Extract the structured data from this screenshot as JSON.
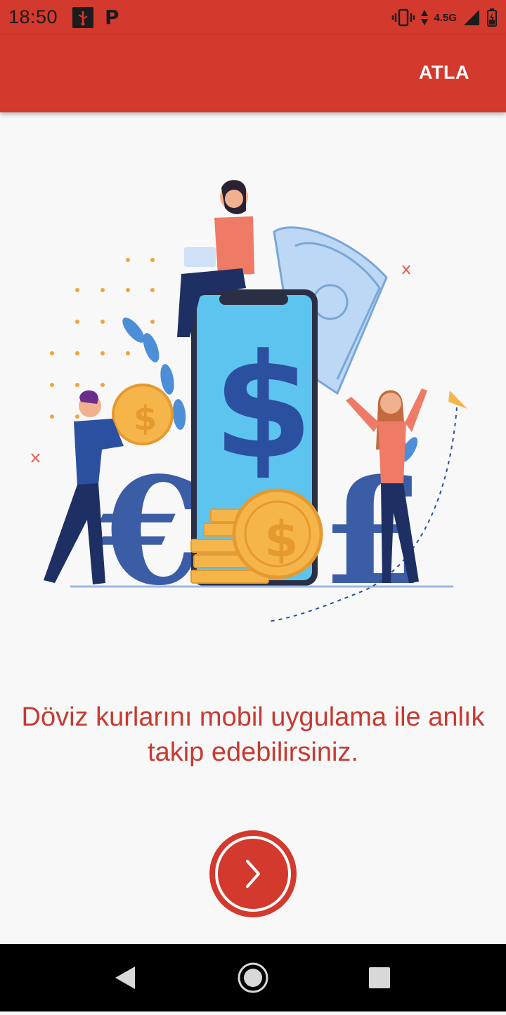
{
  "status_bar": {
    "time": "18:50",
    "network": "4.5G",
    "left_icons": [
      "usb-debug-icon",
      "parking-p-icon"
    ],
    "right_icons": [
      "vibrate-icon",
      "data-arrows-icon",
      "signal-icon",
      "battery-icon"
    ]
  },
  "app_bar": {
    "skip_label": "ATLA"
  },
  "illustration": {
    "icon": "currency-exchange-illustration",
    "symbols": [
      "$",
      "€",
      "£"
    ]
  },
  "onboarding": {
    "message": "Döviz kurlarını mobil uygulama ile anlık takip edebilirsiniz."
  },
  "next_button": {
    "icon": "chevron-right-icon"
  },
  "navigation_bar": {
    "buttons": [
      "back-icon",
      "home-icon",
      "recents-icon"
    ]
  },
  "colors": {
    "primary": "#d3392c",
    "text_accent": "#c83a30",
    "background": "#f8f8f8"
  }
}
